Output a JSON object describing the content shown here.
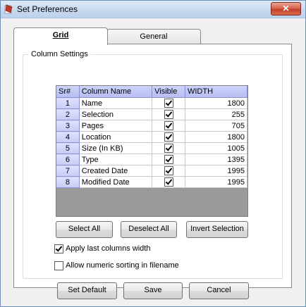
{
  "window": {
    "title": "Set Preferences",
    "close_glyph": "✕"
  },
  "tabs": [
    {
      "label": "Grid",
      "active": true
    },
    {
      "label": "General",
      "active": false
    }
  ],
  "group": {
    "label": "Column Settings"
  },
  "grid": {
    "columns": [
      "Sr#",
      "Column Name",
      "Visible",
      "WIDTH"
    ],
    "rows": [
      {
        "sr": "1",
        "name": "Name",
        "visible": true,
        "width": "1800"
      },
      {
        "sr": "2",
        "name": "Selection",
        "visible": true,
        "width": "255"
      },
      {
        "sr": "3",
        "name": "Pages",
        "visible": true,
        "width": "705"
      },
      {
        "sr": "4",
        "name": "Location",
        "visible": true,
        "width": "1800"
      },
      {
        "sr": "5",
        "name": "Size (In KB)",
        "visible": true,
        "width": "1005"
      },
      {
        "sr": "6",
        "name": "Type",
        "visible": true,
        "width": "1395"
      },
      {
        "sr": "7",
        "name": "Created Date",
        "visible": true,
        "width": "1995"
      },
      {
        "sr": "8",
        "name": "Modified Date",
        "visible": true,
        "width": "1995"
      }
    ]
  },
  "buttons": {
    "select_all": "Select All",
    "deselect_all": "Deselect All",
    "invert_selection": "Invert Selection",
    "set_default": "Set Default",
    "save": "Save",
    "cancel": "Cancel"
  },
  "options": {
    "apply_last_width": {
      "label": "Apply last columns width",
      "checked": true
    },
    "numeric_sorting": {
      "label": "Allow numeric sorting in filename",
      "checked": false
    }
  }
}
